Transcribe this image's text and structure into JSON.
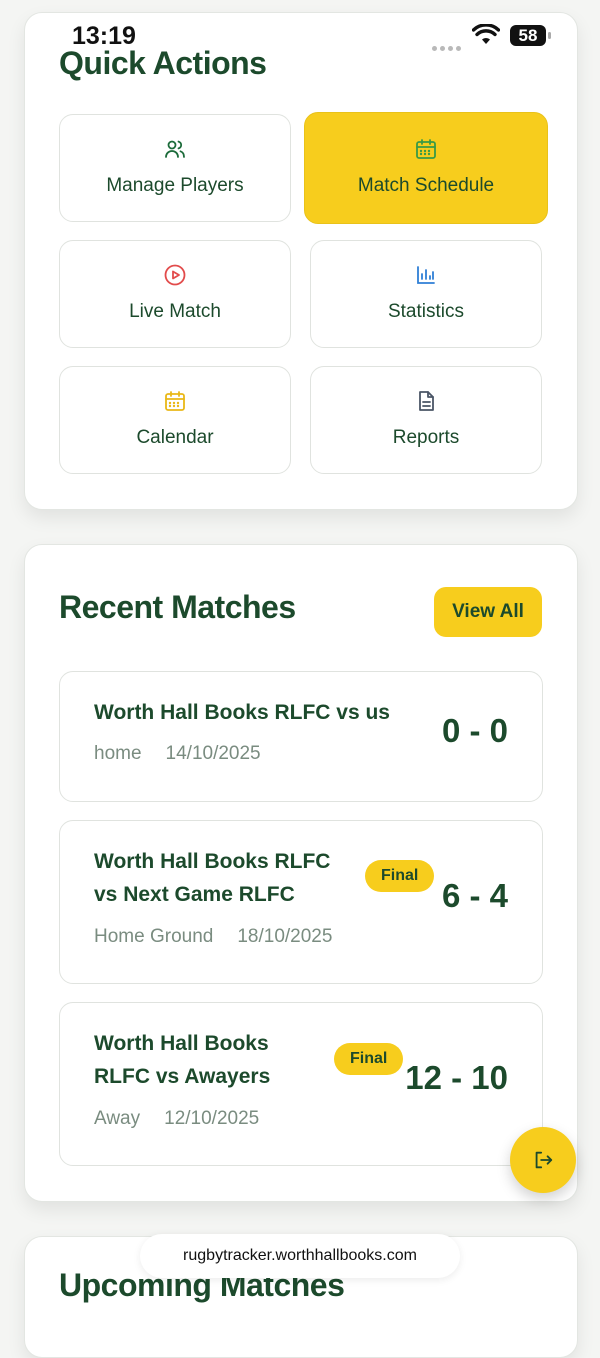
{
  "status_bar": {
    "time": "13:19",
    "battery": "58"
  },
  "quick_actions": {
    "title": "Quick Actions",
    "tiles": [
      {
        "label": "Manage Players",
        "icon": "users-icon",
        "color": "#1c6b3a"
      },
      {
        "label": "Match Schedule",
        "icon": "calendar-icon",
        "color": "#3a9a46",
        "active": true
      },
      {
        "label": "Live Match",
        "icon": "play-circle-icon",
        "color": "#e24b4b"
      },
      {
        "label": "Statistics",
        "icon": "bar-chart-icon",
        "color": "#2f7fd6"
      },
      {
        "label": "Calendar",
        "icon": "calendar-icon",
        "color": "#e9b817"
      },
      {
        "label": "Reports",
        "icon": "document-icon",
        "color": "#4a5566"
      }
    ]
  },
  "recent_matches": {
    "title": "Recent Matches",
    "view_all_label": "View All",
    "matches": [
      {
        "title_line1": "Worth Hall Books RLFC vs us",
        "title_line2": "",
        "venue": "home",
        "date": "14/10/2025",
        "score": "0 - 0",
        "status": ""
      },
      {
        "title_line1": "Worth Hall Books RLFC",
        "title_line2": "vs Next Game RLFC",
        "venue": "Home Ground",
        "date": "18/10/2025",
        "score": "6 - 4",
        "status": "Final"
      },
      {
        "title_line1": "Worth Hall Books",
        "title_line2": "RLFC vs Awayers",
        "venue": "Away",
        "date": "12/10/2025",
        "score": "12 - 10",
        "status": "Final"
      }
    ]
  },
  "upcoming_matches": {
    "title": "Upcoming Matches"
  },
  "browser": {
    "url": "rugbytracker.worthhallbooks.com"
  },
  "colors": {
    "accent": "#f7cd1d",
    "primary_text": "#1c4a2c",
    "muted_text": "#7a8c80"
  }
}
